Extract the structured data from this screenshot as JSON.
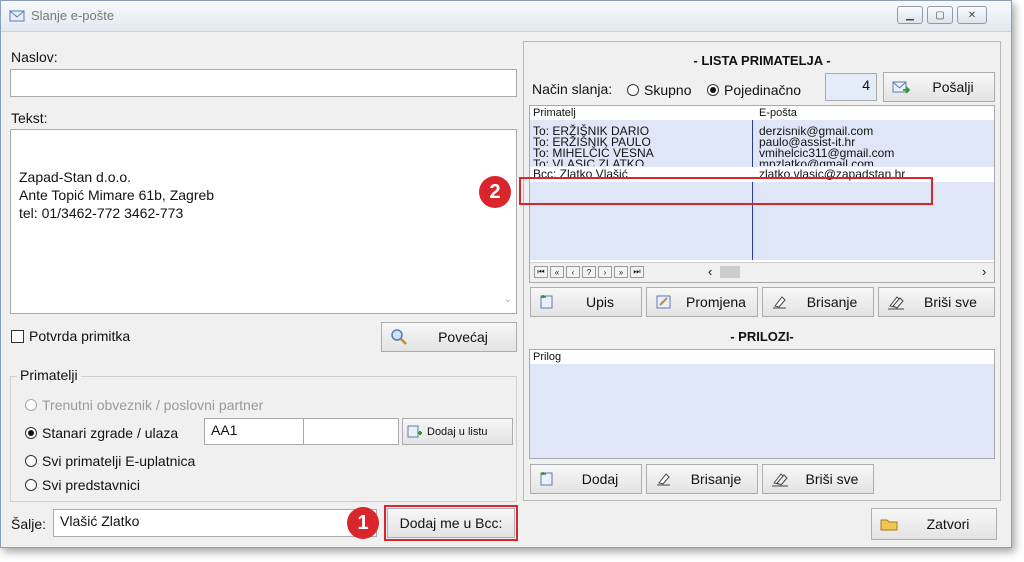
{
  "window": {
    "title": "Slanje e-pošte",
    "min_icon": "minimize-icon",
    "max_icon": "maximize-icon",
    "close_icon": "close-icon"
  },
  "left": {
    "naslov_label": "Naslov:",
    "naslov_value": "",
    "tekst_label": "Tekst:",
    "tekst_lines": [
      "Zapad-Stan d.o.o.",
      "Ante Topić Mimare 61b, Zagreb",
      "tel: 01/3462-772 3462-773"
    ],
    "potvrda_label": "Potvrda primitka",
    "povecaj_label": "Povećaj",
    "primatelji_title": "Primatelji",
    "radio_trenutni": "Trenutni obveznik / poslovni partner",
    "radio_stanari": "Stanari zgrade / ulaza",
    "stanari_value1": "AA1",
    "stanari_value2": "",
    "dodaj_u_listu": "Dodaj u listu",
    "radio_svi_eup": "Svi primatelji E-uplatnica",
    "radio_predstavnici": "Svi predstavnici",
    "salje_label": "Šalje:",
    "salje_value": "Vlašić Zlatko",
    "dodaj_bcc": "Dodaj me u Bcc:"
  },
  "right": {
    "lista_title": "- LISTA PRIMATELJA -",
    "nacin_label": "Način slanja:",
    "opt_skupno": "Skupno",
    "opt_pojedinacno": "Pojedinačno",
    "count": "4",
    "posalji": "Pošalji",
    "col_primatelj": "Primatelj",
    "col_eposta": "E-pošta",
    "rows": [
      {
        "primatelj": "To:  ERŽIŠNIK DARIO",
        "eposta": "derzisnik@gmail.com"
      },
      {
        "primatelj": "To:  ERŽIŠNIK PAULO",
        "eposta": "paulo@assist-it.hr"
      },
      {
        "primatelj": "To:  MIHELČIĆ VESNA",
        "eposta": "vmihelcic311@gmail.com"
      },
      {
        "primatelj": "To:  VLAŠIĆ ZLATKO",
        "eposta": "mpzlatko@gmail.com"
      },
      {
        "primatelj": "Bcc: Zlatko Vlašić",
        "eposta": "zlatko.vlasic@zapadstan.hr"
      }
    ],
    "upis": "Upis",
    "promjena": "Promjena",
    "brisanje": "Brisanje",
    "brisi_sve": "Briši sve",
    "prilozi_title": "- PRILOZI-",
    "col_prilog": "Prilog",
    "dodaj": "Dodaj",
    "brisanje2": "Brisanje",
    "brisi_sve2": "Briši sve",
    "zatvori": "Zatvori"
  },
  "annotations": {
    "badge1": "1",
    "badge2": "2"
  },
  "colors": {
    "accent": "#d9262c",
    "grid_row": "#dfe6f7"
  }
}
